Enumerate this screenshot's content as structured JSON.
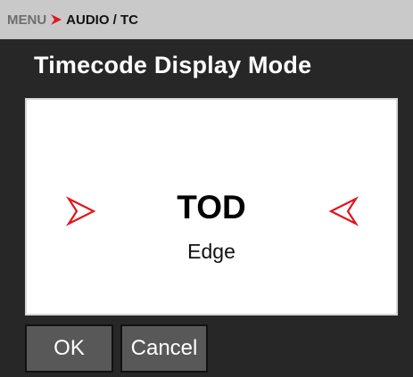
{
  "breadcrumb": {
    "root": "MENU",
    "current": "AUDIO / TC"
  },
  "title": "Timecode Display Mode",
  "selector": {
    "value": "TOD",
    "next_value": "Edge",
    "prev_icon": "chevron-right-outline-icon",
    "next_icon": "chevron-left-outline-icon"
  },
  "buttons": {
    "ok": "OK",
    "cancel": "Cancel"
  },
  "colors": {
    "accent": "#e0161e",
    "header_bg": "#c9c9c9",
    "background": "#272727",
    "button_bg": "#585858"
  }
}
